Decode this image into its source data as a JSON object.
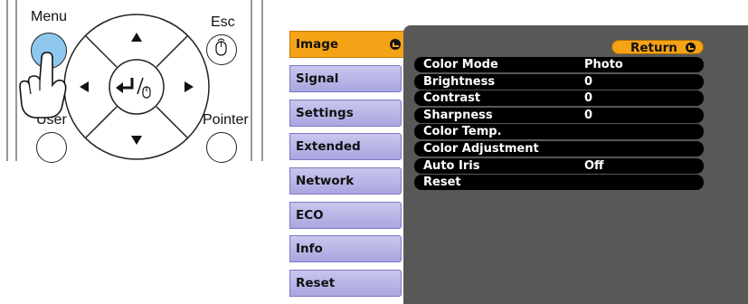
{
  "remote": {
    "menu_label": "Menu",
    "esc_label": "Esc",
    "user_label": "User",
    "pointer_label": "Pointer"
  },
  "tabs": [
    {
      "label": "Image",
      "active": true
    },
    {
      "label": "Signal"
    },
    {
      "label": "Settings"
    },
    {
      "label": "Extended"
    },
    {
      "label": "Network"
    },
    {
      "label": "ECO"
    },
    {
      "label": "Info"
    },
    {
      "label": "Reset"
    }
  ],
  "panel": {
    "return_label": "Return",
    "rows": [
      {
        "label": "Color Mode",
        "value": "Photo"
      },
      {
        "label": "Brightness",
        "value": "0"
      },
      {
        "label": "Contrast",
        "value": "0"
      },
      {
        "label": "Sharpness",
        "value": "0"
      },
      {
        "label": "Color Temp.",
        "value": ""
      },
      {
        "label": "Color Adjustment",
        "value": ""
      },
      {
        "label": "Auto Iris",
        "value": "Off"
      },
      {
        "label": "Reset",
        "value": ""
      }
    ]
  },
  "colors": {
    "accent": "#f5a316",
    "tab": "#b9b5e8",
    "panel": "#585858",
    "row": "#000000",
    "menu_button": "#8fc8ee"
  }
}
